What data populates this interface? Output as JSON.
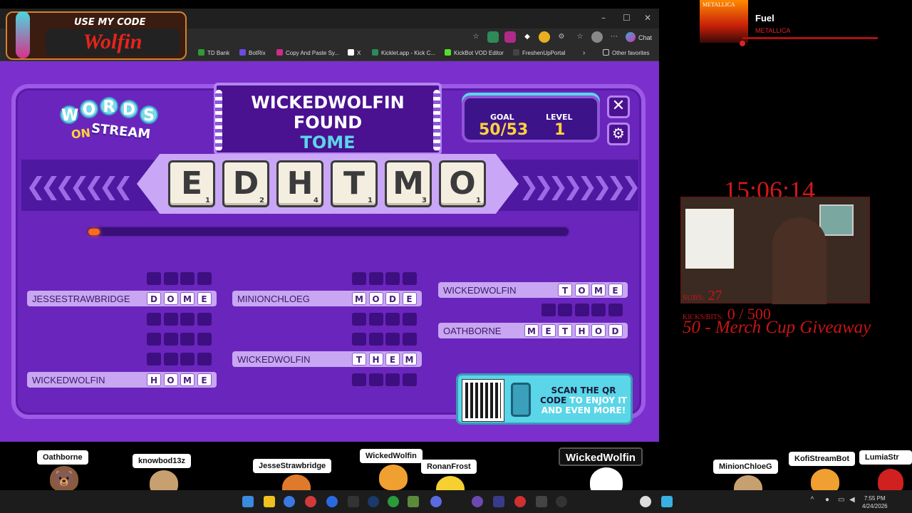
{
  "browser": {
    "bookmarks": [
      "TD Bank",
      "BotRix",
      "Copy And Paste Sy...",
      "X",
      "Kicklet.app - Kick C...",
      "KickBot VOD Editor",
      "FreshenUpPortal",
      "Other favorites"
    ],
    "chat_label": "Chat"
  },
  "code_overlay": {
    "title": "USE MY CODE",
    "name": "Wolfin"
  },
  "game": {
    "logo_letters": [
      "W",
      "O",
      "R",
      "D",
      "S"
    ],
    "logo_on": "ON",
    "logo_stream": "STREAM",
    "banner": {
      "line1": "WICKEDWOLFIN",
      "line2": "FOUND",
      "word": "TOME"
    },
    "goal_label": "GOAL",
    "goal_value": "50/53",
    "level_label": "LEVEL",
    "level_value": "1",
    "close_icon": "close-icon",
    "settings_icon": "gear-icon",
    "tiles": [
      {
        "letter": "E",
        "points": "1"
      },
      {
        "letter": "D",
        "points": "2"
      },
      {
        "letter": "H",
        "points": "4"
      },
      {
        "letter": "T",
        "points": "1"
      },
      {
        "letter": "M",
        "points": "3"
      },
      {
        "letter": "O",
        "points": "1"
      }
    ],
    "progress_fraction": 0.02,
    "columns": [
      [
        {
          "player": "",
          "letters": [
            "",
            "",
            "",
            ""
          ]
        },
        {
          "player": "JESSESTRAWBRIDGE",
          "letters": [
            "D",
            "O",
            "M",
            "E"
          ]
        },
        {
          "player": "",
          "letters": [
            "",
            "",
            "",
            ""
          ]
        },
        {
          "player": "",
          "letters": [
            "",
            "",
            "",
            ""
          ]
        },
        {
          "player": "",
          "letters": [
            "",
            "",
            "",
            ""
          ]
        },
        {
          "player": "WICKEDWOLFIN",
          "letters": [
            "H",
            "O",
            "M",
            "E"
          ]
        }
      ],
      [
        {
          "player": "",
          "letters": [
            "",
            "",
            "",
            ""
          ]
        },
        {
          "player": "MINIONCHLOEG",
          "letters": [
            "M",
            "O",
            "D",
            "E"
          ]
        },
        {
          "player": "",
          "letters": [
            "",
            "",
            "",
            ""
          ]
        },
        {
          "player": "",
          "letters": [
            "",
            "",
            "",
            ""
          ]
        },
        {
          "player": "WICKEDWOLFIN",
          "letters": [
            "T",
            "H",
            "E",
            "M"
          ]
        },
        {
          "player": "",
          "letters": [
            "",
            "",
            "",
            ""
          ]
        }
      ],
      [
        {
          "player": "WICKEDWOLFIN",
          "letters": [
            "T",
            "O",
            "M",
            "E"
          ]
        },
        {
          "player": "",
          "letters": [
            "",
            "",
            "",
            "",
            ""
          ]
        },
        {
          "player": "OATHBORNE",
          "letters": [
            "M",
            "E",
            "T",
            "H",
            "O",
            "D"
          ]
        }
      ]
    ],
    "qr": {
      "line1": "SCAN THE QR",
      "line2a": "CODE",
      "line2b": "TO ENJOY IT",
      "line3": "AND EVEN MORE!"
    }
  },
  "music": {
    "album_text": "METALLICA",
    "song": "Fuel",
    "artist": "METALLICA"
  },
  "stream": {
    "timer": "15:06:14",
    "subs_label": "SUBS:",
    "subs_value": "27",
    "kicks_label": "KICKS/BITS:",
    "kicks_value": "0 / 500",
    "giveaway": "50 - Merch Cup Giveaway"
  },
  "viewers": [
    "Oathborne",
    "knowbod13z",
    "JesseStrawbridge",
    "WickedWolfin",
    "RonanFrost",
    "WickedWolfin",
    "MinionChloeG",
    "KofiStreamBot",
    "LumiaStr"
  ],
  "clock": {
    "time": "7:55 PM",
    "date": "4/24/2026"
  },
  "colors": {
    "game_bg": "#7b2fcc",
    "accent_cyan": "#5ad6e8",
    "gold": "#ffd23a",
    "stream_red": "#c81414"
  }
}
